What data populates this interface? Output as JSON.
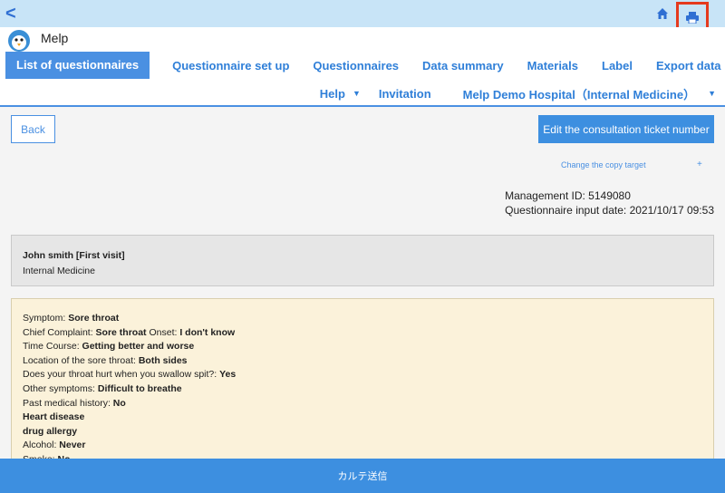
{
  "topbar": {
    "back_label": "<",
    "home_icon": "home-icon",
    "print_icon": "print-icon",
    "highlight_color": "#e53a1e"
  },
  "app": {
    "name": "Melp",
    "logo_icon": "penguin-logo-icon"
  },
  "nav": {
    "tabs": [
      {
        "label": "List of questionnaires",
        "active": true
      },
      {
        "label": "Questionnaire set up"
      },
      {
        "label": "Questionnaires"
      },
      {
        "label": "Data summary"
      },
      {
        "label": "Materials"
      },
      {
        "label": "Label"
      },
      {
        "label": "Export data"
      }
    ],
    "help_label": "Help",
    "invitation_label": "Invitation",
    "hospital_label": "Melp Demo Hospital（Internal Medicine）"
  },
  "actions": {
    "back_label": "Back",
    "edit_label": "Edit the consultation ticket number",
    "copy_target_label": "Change the copy target",
    "plus_label": "+"
  },
  "meta": {
    "management_id": "Management ID: 5149080",
    "input_date": "Questionnaire input date: 2021/10/17 09:53"
  },
  "patient": {
    "name": "John smith [First visit]",
    "department": "Internal Medicine"
  },
  "questionnaire": {
    "symptom_label": "Symptom: ",
    "symptom_value": "Sore throat",
    "complaint_label": "Chief Complaint: ",
    "complaint_value": "Sore throat",
    "onset_label": " Onset: ",
    "onset_value": "I don't know",
    "course_label": "Time Course: ",
    "course_value": "Getting better and worse",
    "location_label": "Location of the sore throat: ",
    "location_value": "Both sides",
    "swallow_label": "Does your throat hurt when you swallow spit?: ",
    "swallow_value": "Yes",
    "other_label": "Other symptoms: ",
    "other_value": "Difficult to breathe",
    "history_label": "Past medical history: ",
    "history_value": "No",
    "history_item1": "Heart disease",
    "history_item2": "drug allergy",
    "alcohol_label": "Alcohol: ",
    "alcohol_value": "Never",
    "smoke_label": "Smoke: ",
    "smoke_value": "No"
  },
  "footer": {
    "label": "カルテ送信"
  }
}
